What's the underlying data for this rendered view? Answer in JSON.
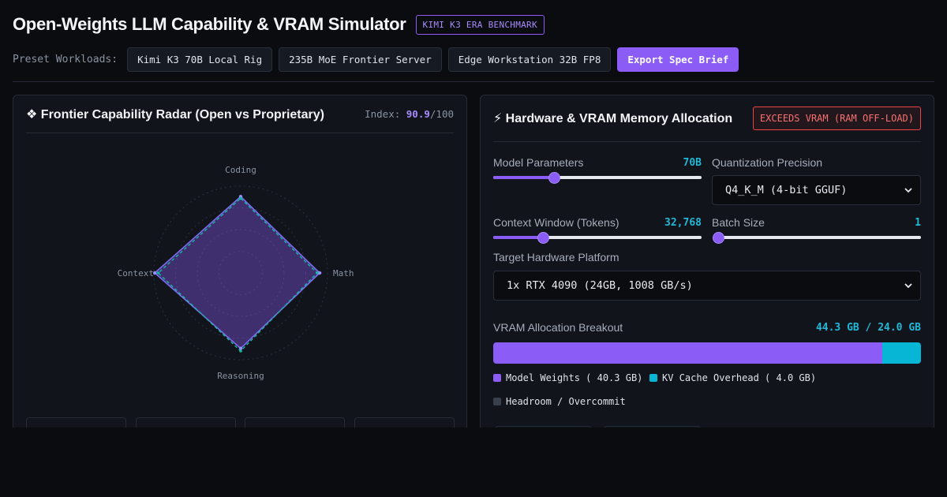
{
  "header": {
    "title": "Open-Weights LLM Capability & VRAM Simulator",
    "badge": "KIMI K3 ERA BENCHMARK"
  },
  "presets": {
    "label": "Preset Workloads:",
    "items": [
      "Kimi K3 70B Local Rig",
      "235B MoE Frontier Server",
      "Edge Workstation 32B FP8"
    ],
    "export_label": "Export Spec Brief"
  },
  "radar_panel": {
    "title": "❖ Frontier Capability Radar (Open vs Proprietary)",
    "index_label": "Index:",
    "index_value": "90.9",
    "index_max": "/100",
    "axes": [
      "Coding",
      "Math",
      "Reasoning",
      "Context"
    ],
    "series": [
      {
        "values": [
          0.88,
          0.91,
          0.87,
          0.99
        ],
        "color": "#8b5cf6"
      },
      {
        "values": [
          0.86,
          0.88,
          0.9,
          0.95
        ],
        "color": "#10b9a0"
      }
    ],
    "accent": "#8b5cf6"
  },
  "hardware_panel": {
    "title": "⚡ Hardware & VRAM Memory Allocation",
    "status": "EXCEEDS VRAM (RAM OFF-LOAD)",
    "model_params": {
      "label": "Model Parameters",
      "value": "70B",
      "fraction": 0.29
    },
    "quantization": {
      "label": "Quantization Precision",
      "selected": "Q4_K_M (4-bit GGUF)"
    },
    "context_window": {
      "label": "Context Window (Tokens)",
      "value": "32,768",
      "fraction": 0.24
    },
    "batch_size": {
      "label": "Batch Size",
      "value": "1",
      "fraction": 0.0
    },
    "target_hw": {
      "label": "Target Hardware Platform",
      "selected": "1x RTX 4090 (24GB, 1008 GB/s)"
    },
    "vram": {
      "label": "VRAM Allocation Breakout",
      "readout": "44.3 GB / 24.0 GB",
      "weights_gb": 40.3,
      "kv_gb": 4.0,
      "legend": {
        "weights": "Model Weights ( 40.3 GB)",
        "kv": "KV Cache Overhead ( 4.0 GB)",
        "headroom": "Headroom / Overcommit"
      },
      "colors": {
        "weights": "#8b5cf6",
        "kv": "#06b6d4",
        "headroom": "#3a404b"
      }
    },
    "status_color": "#ef4444"
  }
}
